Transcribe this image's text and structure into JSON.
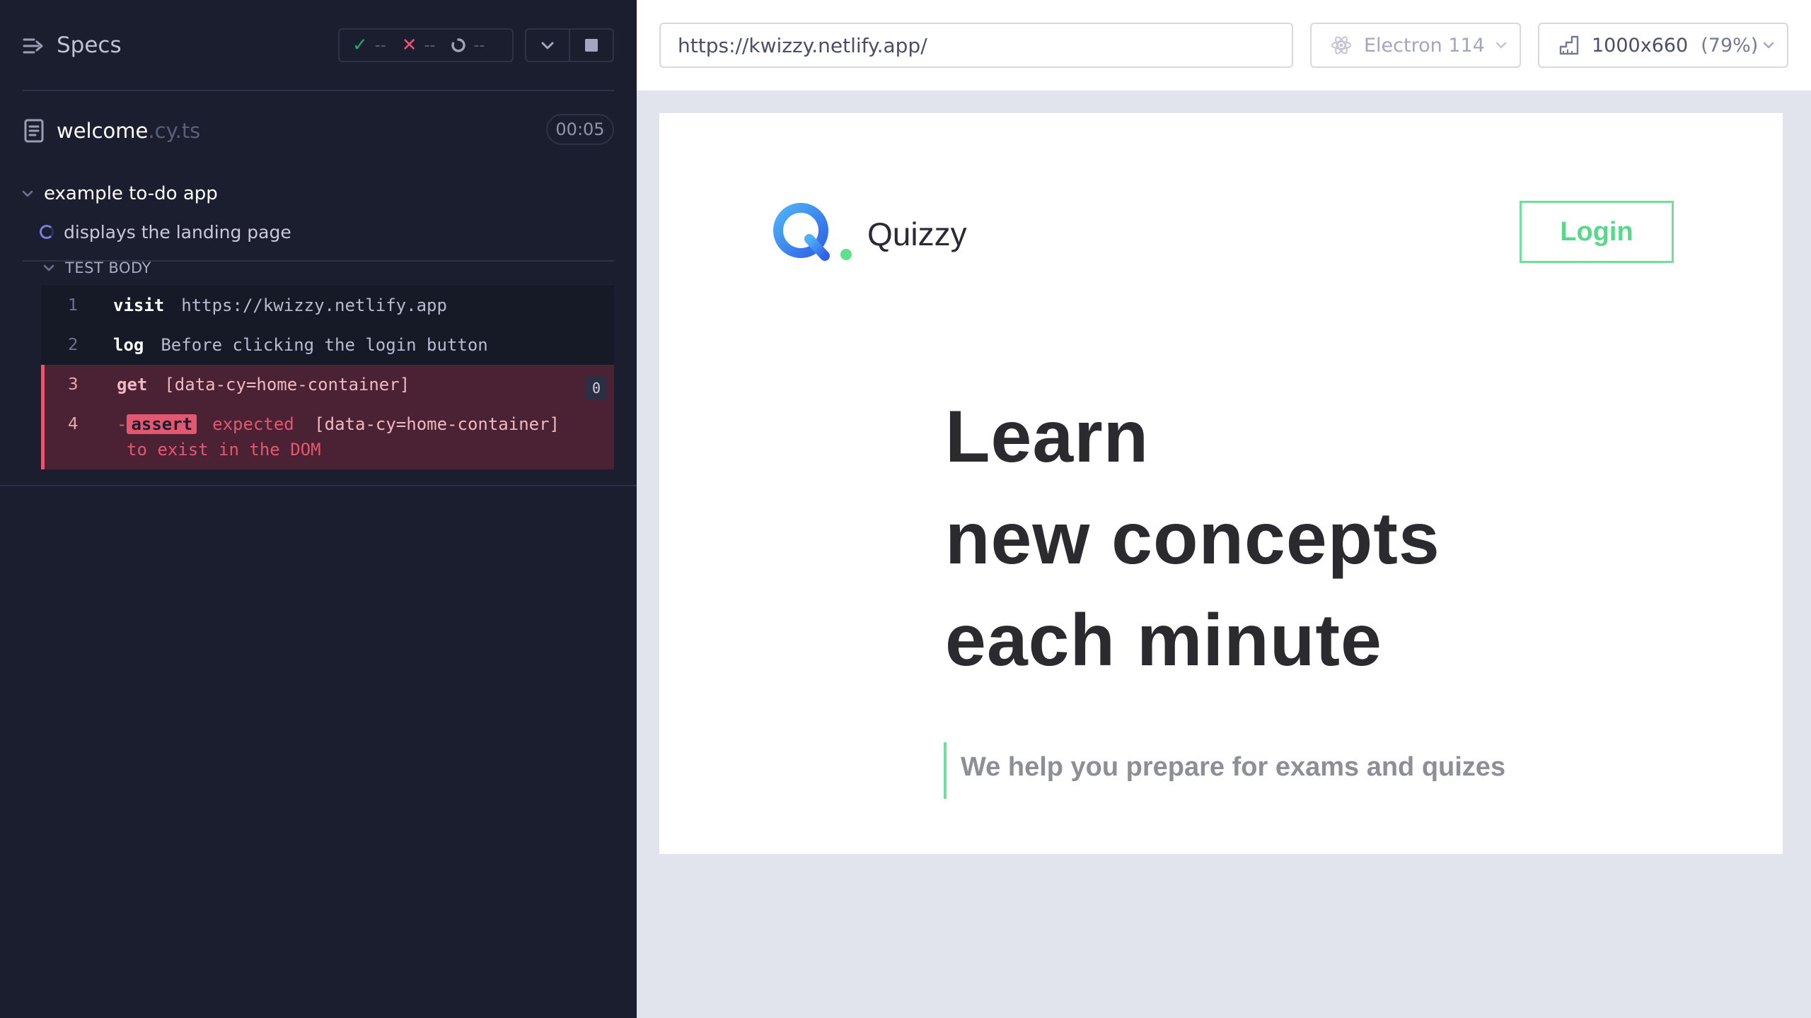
{
  "runner": {
    "header": {
      "specs_label": "Specs",
      "passed": "--",
      "failed": "--",
      "pending": "--"
    },
    "spec": {
      "file_base": "welcome",
      "file_ext": ".cy.ts",
      "duration": "00:05"
    },
    "suite": {
      "title": "example to-do app"
    },
    "test": {
      "title": "displays the landing page",
      "body_label": "TEST BODY"
    },
    "commands": [
      {
        "num": "1",
        "name": "visit",
        "message": "https://kwizzy.netlify.app"
      },
      {
        "num": "2",
        "name": "log",
        "message": "Before clicking the login button"
      },
      {
        "num": "3",
        "name": "get",
        "message": "[data-cy=home-container]",
        "count": "0"
      },
      {
        "num": "4",
        "prefix": "-",
        "name": "assert",
        "expected_word": "expected",
        "selector": "[data-cy=home-container]",
        "tail": "to exist in the DOM"
      }
    ]
  },
  "aut": {
    "url": "https://kwizzy.netlify.app/",
    "browser": "Electron 114",
    "viewport": "1000x660",
    "scale": "(79%)"
  },
  "site": {
    "brand": "Quizzy",
    "login_label": "Login",
    "hero_lines": [
      "Learn",
      "new concepts",
      "each minute"
    ],
    "tagline": "We help you prepare for exams and quizes"
  },
  "colors": {
    "runner_bg": "#1b1e2e",
    "pass": "#1fa971",
    "fail": "#e45770",
    "accent_green": "#6fe09a",
    "logo_blue": "#2f7ef0"
  }
}
